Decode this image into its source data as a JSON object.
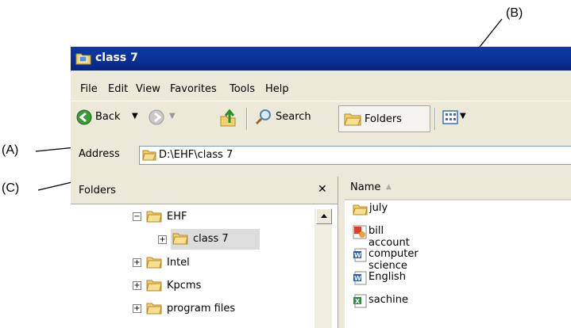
{
  "window": {
    "title": "class 7"
  },
  "menu": [
    "File",
    "Edit",
    "View",
    "Favorites",
    "Tools",
    "Help"
  ],
  "toolbar": {
    "back_label": "Back",
    "search_label": "Search",
    "folders_label": "Folders"
  },
  "address": {
    "label": "Address",
    "value": "D:\\EHF\\class 7"
  },
  "folders_pane": {
    "title": "Folders",
    "close_glyph": "✕",
    "tree": [
      {
        "label": "EHF",
        "expander": "−"
      },
      {
        "label": "class 7",
        "expander": "+"
      },
      {
        "label": "Intel",
        "expander": "+"
      },
      {
        "label": "Kpcms",
        "expander": "+"
      },
      {
        "label": "program files",
        "expander": "+"
      }
    ]
  },
  "files_pane": {
    "column_header": "Name",
    "sort_glyph": "▲",
    "files": [
      {
        "name": "july",
        "icon": "folder-icon"
      },
      {
        "name": "bill account",
        "icon": "powerpoint-file-icon"
      },
      {
        "name": "computer science",
        "icon": "word-file-icon"
      },
      {
        "name": "English",
        "icon": "word-file-icon"
      },
      {
        "name": "sachine",
        "icon": "excel-file-icon"
      }
    ]
  },
  "annotations": {
    "a": "(A)",
    "b": "(B)",
    "c": "(C)"
  },
  "colors": {
    "titlebar": "#0b2f92",
    "chrome": "#ece9d8",
    "folder": "#f3d06b"
  }
}
